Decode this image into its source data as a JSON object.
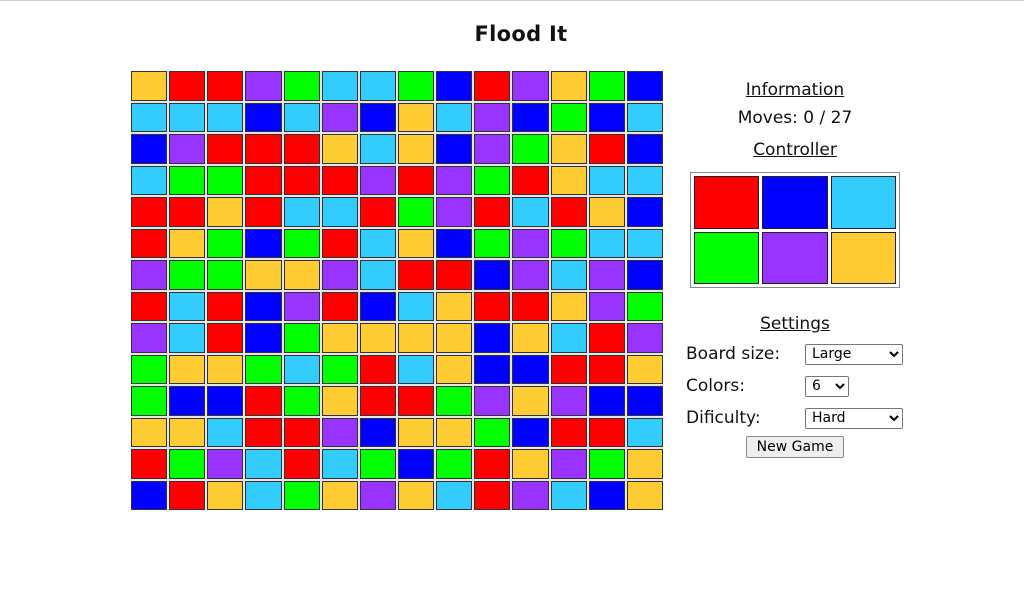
{
  "title": "Flood It",
  "palette": {
    "R": "#ff0000",
    "B": "#0000ff",
    "C": "#33ccff",
    "G": "#00ff00",
    "P": "#9933ff",
    "Y": "#ffcc33"
  },
  "board": {
    "size": 14,
    "rows": [
      "YRRPGCCGBRPYGB",
      "CCCBCPBYCPBGBC",
      "BPRRRYCYBPGYRB",
      "CGGRRRPRPGRYCC",
      "RRYRCCRGPRCRYB",
      "RYGBGRCYBGPGCC",
      "PGGYYPCRRBPCPB",
      "RCRBPRBCYRRYPG",
      "PCRBGYYYYBYCRP",
      "GYYGCGRCYBBRRY",
      "GBBRGYRRGPYPBB",
      "YYCRRPBYYGBRRC",
      "RGPCRCGBGRYPGY",
      "BRYCGYPYCRPCBY"
    ]
  },
  "info": {
    "heading": "Information",
    "moves_label": "Moves:",
    "moves_current": 0,
    "moves_max": 27,
    "moves_text": "Moves: 0 / 27"
  },
  "controller": {
    "heading": "Controller",
    "buttons": [
      {
        "color_key": "R",
        "name": "red"
      },
      {
        "color_key": "B",
        "name": "blue"
      },
      {
        "color_key": "C",
        "name": "cyan"
      },
      {
        "color_key": "G",
        "name": "green"
      },
      {
        "color_key": "P",
        "name": "purple"
      },
      {
        "color_key": "Y",
        "name": "yellow"
      }
    ]
  },
  "settings": {
    "heading": "Settings",
    "board_size": {
      "label": "Board size:",
      "value": "Large"
    },
    "colors": {
      "label": "Colors:",
      "value": "6"
    },
    "difficulty": {
      "label": "Dificulty:",
      "value": "Hard"
    },
    "new_game_label": "New Game"
  }
}
